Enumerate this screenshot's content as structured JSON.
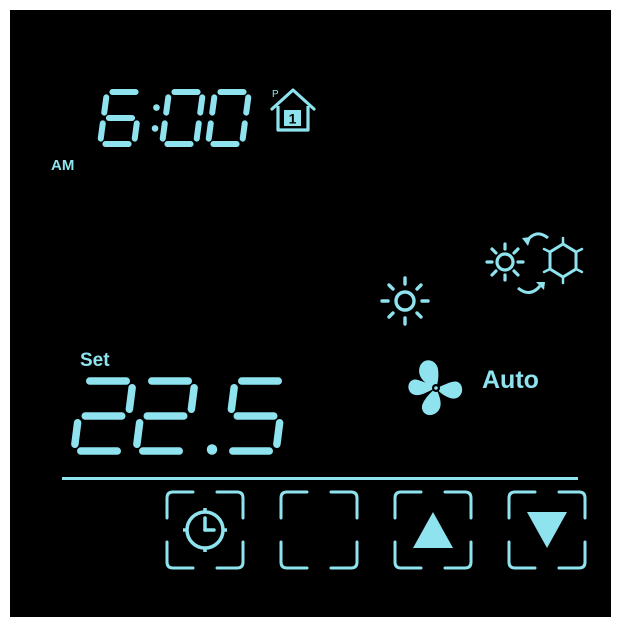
{
  "colors": {
    "background": "#000000",
    "accent": "#8ee3ef"
  },
  "clock": {
    "time": "6:00",
    "meridiem": "AM",
    "period_badge": "P",
    "period_number": "1"
  },
  "setpoint": {
    "label": "Set",
    "value": "22.5"
  },
  "fan": {
    "mode": "Auto"
  },
  "icons": {
    "program": "home-icon",
    "heating": "sun-icon",
    "heat_cool": "heat-cool-switch-icon",
    "fan": "fan-icon"
  },
  "buttons": [
    {
      "name": "clock-button",
      "icon": "clock-icon"
    },
    {
      "name": "blank-button",
      "icon": ""
    },
    {
      "name": "up-button",
      "icon": "triangle-up-icon"
    },
    {
      "name": "down-button",
      "icon": "triangle-down-icon"
    }
  ]
}
